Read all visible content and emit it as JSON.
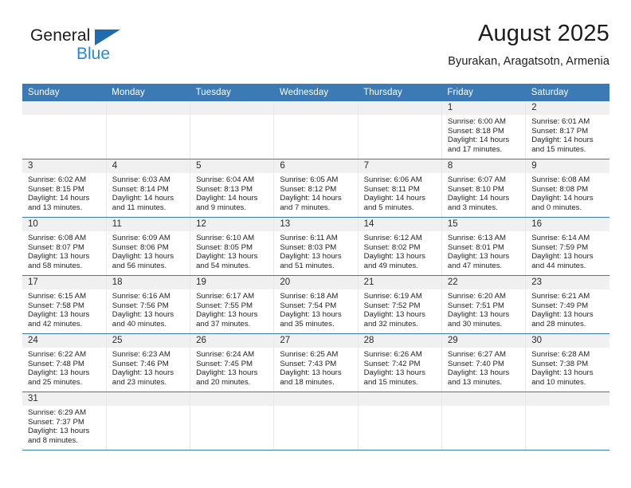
{
  "brand": {
    "name_top": "General",
    "name_bottom": "Blue",
    "triangle_color": "#1f6bb0",
    "blue_color": "#2789d8"
  },
  "header": {
    "title": "August 2025",
    "subtitle": "Byurakan, Aragatsotn, Armenia"
  },
  "theme": {
    "header_blue": "#3b7ab5",
    "daynum_band": "#f0f0f0",
    "row_border": "#3b7ab5",
    "text": "#242424"
  },
  "weekday_headers": [
    "Sunday",
    "Monday",
    "Tuesday",
    "Wednesday",
    "Thursday",
    "Friday",
    "Saturday"
  ],
  "weeks": [
    [
      {
        "day": ""
      },
      {
        "day": ""
      },
      {
        "day": ""
      },
      {
        "day": ""
      },
      {
        "day": ""
      },
      {
        "day": "1",
        "sunrise": "Sunrise: 6:00 AM",
        "sunset": "Sunset: 8:18 PM",
        "daylight_1": "Daylight: 14 hours",
        "daylight_2": "and 17 minutes."
      },
      {
        "day": "2",
        "sunrise": "Sunrise: 6:01 AM",
        "sunset": "Sunset: 8:17 PM",
        "daylight_1": "Daylight: 14 hours",
        "daylight_2": "and 15 minutes."
      }
    ],
    [
      {
        "day": "3",
        "sunrise": "Sunrise: 6:02 AM",
        "sunset": "Sunset: 8:15 PM",
        "daylight_1": "Daylight: 14 hours",
        "daylight_2": "and 13 minutes."
      },
      {
        "day": "4",
        "sunrise": "Sunrise: 6:03 AM",
        "sunset": "Sunset: 8:14 PM",
        "daylight_1": "Daylight: 14 hours",
        "daylight_2": "and 11 minutes."
      },
      {
        "day": "5",
        "sunrise": "Sunrise: 6:04 AM",
        "sunset": "Sunset: 8:13 PM",
        "daylight_1": "Daylight: 14 hours",
        "daylight_2": "and 9 minutes."
      },
      {
        "day": "6",
        "sunrise": "Sunrise: 6:05 AM",
        "sunset": "Sunset: 8:12 PM",
        "daylight_1": "Daylight: 14 hours",
        "daylight_2": "and 7 minutes."
      },
      {
        "day": "7",
        "sunrise": "Sunrise: 6:06 AM",
        "sunset": "Sunset: 8:11 PM",
        "daylight_1": "Daylight: 14 hours",
        "daylight_2": "and 5 minutes."
      },
      {
        "day": "8",
        "sunrise": "Sunrise: 6:07 AM",
        "sunset": "Sunset: 8:10 PM",
        "daylight_1": "Daylight: 14 hours",
        "daylight_2": "and 3 minutes."
      },
      {
        "day": "9",
        "sunrise": "Sunrise: 6:08 AM",
        "sunset": "Sunset: 8:08 PM",
        "daylight_1": "Daylight: 14 hours",
        "daylight_2": "and 0 minutes."
      }
    ],
    [
      {
        "day": "10",
        "sunrise": "Sunrise: 6:08 AM",
        "sunset": "Sunset: 8:07 PM",
        "daylight_1": "Daylight: 13 hours",
        "daylight_2": "and 58 minutes."
      },
      {
        "day": "11",
        "sunrise": "Sunrise: 6:09 AM",
        "sunset": "Sunset: 8:06 PM",
        "daylight_1": "Daylight: 13 hours",
        "daylight_2": "and 56 minutes."
      },
      {
        "day": "12",
        "sunrise": "Sunrise: 6:10 AM",
        "sunset": "Sunset: 8:05 PM",
        "daylight_1": "Daylight: 13 hours",
        "daylight_2": "and 54 minutes."
      },
      {
        "day": "13",
        "sunrise": "Sunrise: 6:11 AM",
        "sunset": "Sunset: 8:03 PM",
        "daylight_1": "Daylight: 13 hours",
        "daylight_2": "and 51 minutes."
      },
      {
        "day": "14",
        "sunrise": "Sunrise: 6:12 AM",
        "sunset": "Sunset: 8:02 PM",
        "daylight_1": "Daylight: 13 hours",
        "daylight_2": "and 49 minutes."
      },
      {
        "day": "15",
        "sunrise": "Sunrise: 6:13 AM",
        "sunset": "Sunset: 8:01 PM",
        "daylight_1": "Daylight: 13 hours",
        "daylight_2": "and 47 minutes."
      },
      {
        "day": "16",
        "sunrise": "Sunrise: 6:14 AM",
        "sunset": "Sunset: 7:59 PM",
        "daylight_1": "Daylight: 13 hours",
        "daylight_2": "and 44 minutes."
      }
    ],
    [
      {
        "day": "17",
        "sunrise": "Sunrise: 6:15 AM",
        "sunset": "Sunset: 7:58 PM",
        "daylight_1": "Daylight: 13 hours",
        "daylight_2": "and 42 minutes."
      },
      {
        "day": "18",
        "sunrise": "Sunrise: 6:16 AM",
        "sunset": "Sunset: 7:56 PM",
        "daylight_1": "Daylight: 13 hours",
        "daylight_2": "and 40 minutes."
      },
      {
        "day": "19",
        "sunrise": "Sunrise: 6:17 AM",
        "sunset": "Sunset: 7:55 PM",
        "daylight_1": "Daylight: 13 hours",
        "daylight_2": "and 37 minutes."
      },
      {
        "day": "20",
        "sunrise": "Sunrise: 6:18 AM",
        "sunset": "Sunset: 7:54 PM",
        "daylight_1": "Daylight: 13 hours",
        "daylight_2": "and 35 minutes."
      },
      {
        "day": "21",
        "sunrise": "Sunrise: 6:19 AM",
        "sunset": "Sunset: 7:52 PM",
        "daylight_1": "Daylight: 13 hours",
        "daylight_2": "and 32 minutes."
      },
      {
        "day": "22",
        "sunrise": "Sunrise: 6:20 AM",
        "sunset": "Sunset: 7:51 PM",
        "daylight_1": "Daylight: 13 hours",
        "daylight_2": "and 30 minutes."
      },
      {
        "day": "23",
        "sunrise": "Sunrise: 6:21 AM",
        "sunset": "Sunset: 7:49 PM",
        "daylight_1": "Daylight: 13 hours",
        "daylight_2": "and 28 minutes."
      }
    ],
    [
      {
        "day": "24",
        "sunrise": "Sunrise: 6:22 AM",
        "sunset": "Sunset: 7:48 PM",
        "daylight_1": "Daylight: 13 hours",
        "daylight_2": "and 25 minutes."
      },
      {
        "day": "25",
        "sunrise": "Sunrise: 6:23 AM",
        "sunset": "Sunset: 7:46 PM",
        "daylight_1": "Daylight: 13 hours",
        "daylight_2": "and 23 minutes."
      },
      {
        "day": "26",
        "sunrise": "Sunrise: 6:24 AM",
        "sunset": "Sunset: 7:45 PM",
        "daylight_1": "Daylight: 13 hours",
        "daylight_2": "and 20 minutes."
      },
      {
        "day": "27",
        "sunrise": "Sunrise: 6:25 AM",
        "sunset": "Sunset: 7:43 PM",
        "daylight_1": "Daylight: 13 hours",
        "daylight_2": "and 18 minutes."
      },
      {
        "day": "28",
        "sunrise": "Sunrise: 6:26 AM",
        "sunset": "Sunset: 7:42 PM",
        "daylight_1": "Daylight: 13 hours",
        "daylight_2": "and 15 minutes."
      },
      {
        "day": "29",
        "sunrise": "Sunrise: 6:27 AM",
        "sunset": "Sunset: 7:40 PM",
        "daylight_1": "Daylight: 13 hours",
        "daylight_2": "and 13 minutes."
      },
      {
        "day": "30",
        "sunrise": "Sunrise: 6:28 AM",
        "sunset": "Sunset: 7:38 PM",
        "daylight_1": "Daylight: 13 hours",
        "daylight_2": "and 10 minutes."
      }
    ],
    [
      {
        "day": "31",
        "sunrise": "Sunrise: 6:29 AM",
        "sunset": "Sunset: 7:37 PM",
        "daylight_1": "Daylight: 13 hours",
        "daylight_2": "and 8 minutes."
      },
      {
        "day": ""
      },
      {
        "day": ""
      },
      {
        "day": ""
      },
      {
        "day": ""
      },
      {
        "day": ""
      },
      {
        "day": ""
      }
    ]
  ]
}
